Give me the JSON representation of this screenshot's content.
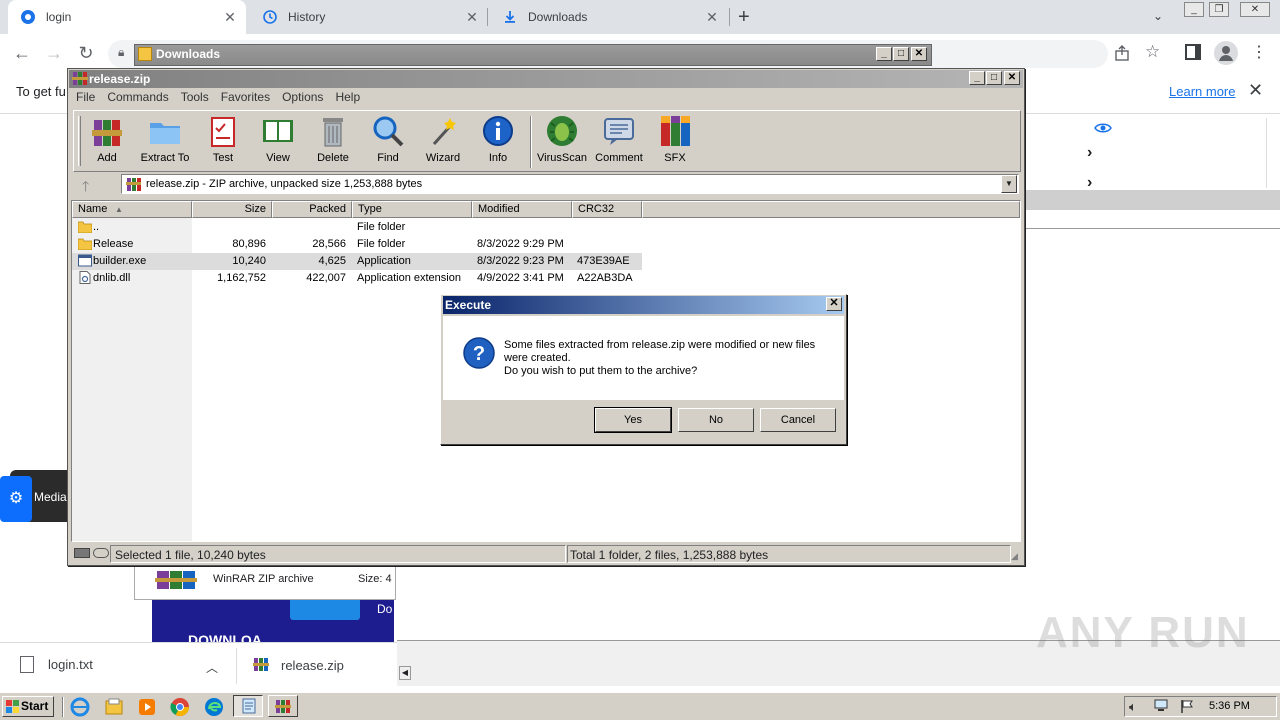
{
  "browser": {
    "tabs": [
      {
        "label": "login",
        "active": true
      },
      {
        "label": "History",
        "active": false
      },
      {
        "label": "Downloads",
        "active": false
      }
    ],
    "new_tab_label": "+",
    "infobar_text": "To get fu",
    "learn_more": "Learn more"
  },
  "page": {
    "media_text": "MediaF",
    "rar_row_name": "WinRAR ZIP archive",
    "rar_row_size": "Size: 4",
    "ad_text": "DOWNLOA",
    "ad_right": "Do"
  },
  "downloads_shelf": [
    {
      "name": "login.txt"
    },
    {
      "name": "release.zip"
    }
  ],
  "explorer": {
    "title": "Downloads"
  },
  "winrar": {
    "title": "release.zip",
    "menu": [
      "File",
      "Commands",
      "Tools",
      "Favorites",
      "Options",
      "Help"
    ],
    "tools": [
      {
        "label": "Add",
        "icon": "add-archive-icon"
      },
      {
        "label": "Extract To",
        "icon": "extract-folder-icon"
      },
      {
        "label": "Test",
        "icon": "test-clipboard-icon"
      },
      {
        "label": "View",
        "icon": "view-book-icon"
      },
      {
        "label": "Delete",
        "icon": "trash-icon"
      },
      {
        "label": "Find",
        "icon": "magnifier-icon"
      },
      {
        "label": "Wizard",
        "icon": "wand-icon"
      },
      {
        "label": "Info",
        "icon": "info-icon"
      },
      {
        "label": "VirusScan",
        "icon": "bug-icon"
      },
      {
        "label": "Comment",
        "icon": "comment-icon"
      },
      {
        "label": "SFX",
        "icon": "sfx-books-icon"
      }
    ],
    "address": "release.zip - ZIP archive, unpacked size 1,253,888 bytes",
    "columns": [
      "Name",
      "Size",
      "Packed",
      "Type",
      "Modified",
      "CRC32"
    ],
    "rows": [
      {
        "name": "..",
        "size": "",
        "packed": "",
        "type": "File folder",
        "modified": "",
        "crc": "",
        "icon": "folder"
      },
      {
        "name": "Release",
        "size": "80,896",
        "packed": "28,566",
        "type": "File folder",
        "modified": "8/3/2022 9:29 PM",
        "crc": "",
        "icon": "folder"
      },
      {
        "name": "builder.exe",
        "size": "10,240",
        "packed": "4,625",
        "type": "Application",
        "modified": "8/3/2022 9:23 PM",
        "crc": "473E39AE",
        "icon": "exe"
      },
      {
        "name": "dnlib.dll",
        "size": "1,162,752",
        "packed": "422,007",
        "type": "Application extension",
        "modified": "4/9/2022 3:41 PM",
        "crc": "A22AB3DA",
        "icon": "dll"
      }
    ],
    "selected_row": 2,
    "status_left": "Selected 1 file, 10,240 bytes",
    "status_right": "Total 1 folder, 2 files, 1,253,888 bytes"
  },
  "dialog": {
    "title": "Execute",
    "message_line1": "Some files extracted from release.zip were modified or new files",
    "message_line2": "were created.",
    "message_line3": "Do you wish to put them to the archive?",
    "yes": "Yes",
    "no": "No",
    "cancel": "Cancel"
  },
  "taskbar": {
    "start": "Start",
    "clock": "5:36 PM"
  },
  "watermark": "ANY RUN"
}
